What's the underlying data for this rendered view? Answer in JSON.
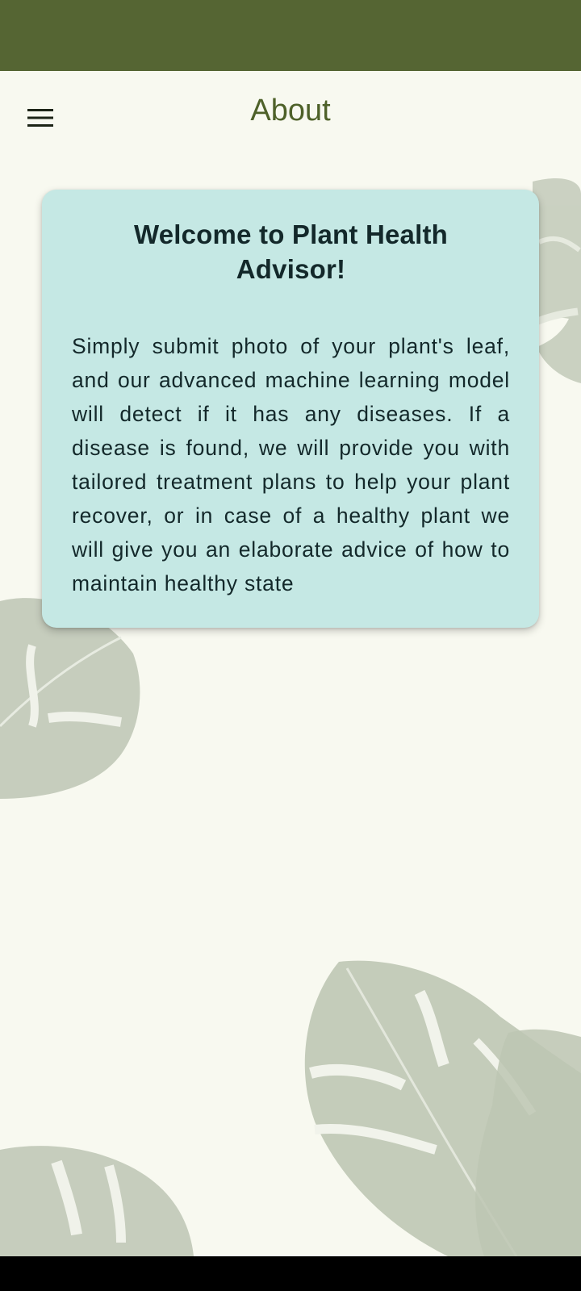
{
  "app_bar": {
    "title": "About",
    "menu_icon": "hamburger-menu-icon"
  },
  "card": {
    "title": "Welcome to Plant Health Advisor!",
    "body": "Simply submit photo of your plant's leaf, and our advanced machine learning model will detect if it has any diseases. If a disease is found, we will provide you with tailored treatment plans to help your plant recover, or in case of a healthy plant we will give you an elaborate advice of how to maintain healthy state"
  },
  "colors": {
    "status_bar": "#556533",
    "background": "#f8f9f0",
    "title_text": "#4e6129",
    "card_background": "#c5e8e4",
    "card_text": "#13282a",
    "leaf_fill": "#c9d0c0",
    "leaf_vein": "#e6eadf",
    "navigation_bar": "#000000"
  },
  "background": {
    "decoration": "monstera-leaves"
  }
}
